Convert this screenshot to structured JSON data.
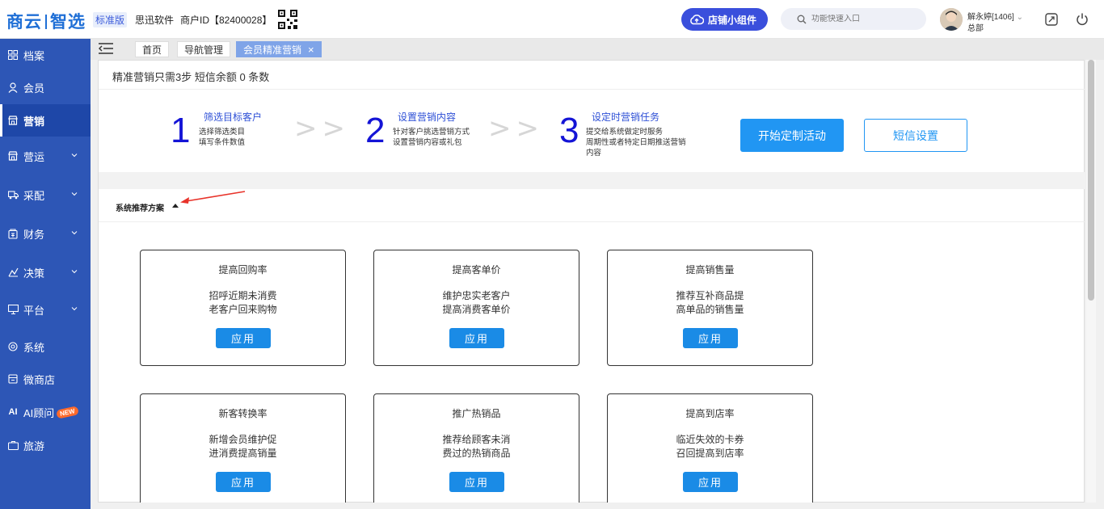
{
  "header": {
    "logo_left": "商云",
    "logo_right": "智选",
    "edition": "标准版",
    "company": "思迅软件",
    "merchant": "商户ID【82400028】",
    "widget_button": "店铺小组件",
    "search_placeholder": "功能快速入口",
    "user_name": "解永婷[1406]",
    "user_dept": "总部"
  },
  "sidebar": {
    "items": [
      {
        "label": "档案",
        "icon": "grid-icon"
      },
      {
        "label": "会员",
        "icon": "person-icon"
      },
      {
        "label": "营销",
        "icon": "store-icon",
        "active": true
      },
      {
        "label": "营运",
        "icon": "store-icon"
      },
      {
        "label": "采配",
        "icon": "truck-icon"
      },
      {
        "label": "财务",
        "icon": "wallet-icon"
      },
      {
        "label": "决策",
        "icon": "decision-icon"
      },
      {
        "label": "平台",
        "icon": "monitor-icon"
      },
      {
        "label": "系统",
        "icon": "settings-icon"
      },
      {
        "label": "微商店",
        "icon": "shop-icon"
      },
      {
        "label": "AI顾问",
        "icon": "ai-icon",
        "badge": "NEW"
      },
      {
        "label": "旅游",
        "icon": "travel-icon"
      }
    ]
  },
  "tabs": [
    {
      "label": "首页"
    },
    {
      "label": "导航管理"
    },
    {
      "label": "会员精准营销",
      "active": true
    }
  ],
  "main": {
    "notice": "精准营销只需3步  短信余额 0 条数",
    "steps": [
      {
        "num": "1",
        "title": "筛选目标客户",
        "desc": [
          "选择筛选类目",
          "填写条件数值"
        ]
      },
      {
        "num": "2",
        "title": "设置营销内容",
        "desc": [
          "针对客户挑选营销方式",
          "设置营销内容或礼包"
        ]
      },
      {
        "num": "3",
        "title": "设定时营销任务",
        "desc": [
          "提交给系统做定时服务",
          "周期性或者特定日期推送营销",
          "内容"
        ]
      }
    ],
    "arrows": ">>",
    "start_button": "开始定制活动",
    "sms_button": "短信设置",
    "section_title": "系统推荐方案",
    "cards": [
      {
        "title": "提高回购率",
        "desc": [
          "招呼近期未消费",
          "老客户回来购物"
        ],
        "button": "应用"
      },
      {
        "title": "提高客单价",
        "desc": [
          "维护忠实老客户",
          "提高消费客单价"
        ],
        "button": "应用"
      },
      {
        "title": "提高销售量",
        "desc": [
          "推荐互补商品提",
          "高单品的销售量"
        ],
        "button": "应用"
      },
      {
        "title": "新客转换率",
        "desc": [
          "新增会员维护促",
          "进消费提高销量"
        ],
        "button": "应用"
      },
      {
        "title": "推广热销品",
        "desc": [
          "推荐给顾客未消",
          "费过的热销商品"
        ],
        "button": "应用"
      },
      {
        "title": "提高到店率",
        "desc": [
          "临近失效的卡券",
          "召回提高到店率"
        ],
        "button": "应用"
      }
    ]
  },
  "colors": {
    "sidebar": "#2d56b6",
    "primary_button": "#2196f3",
    "widget_button": "#3a4fdc",
    "step_number": "#1414d6",
    "active_tab": "#7fa4e8"
  }
}
